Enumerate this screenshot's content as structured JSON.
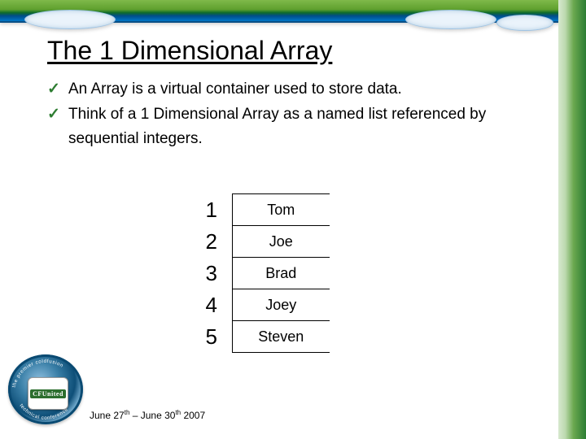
{
  "title": "The 1 Dimensional Array",
  "bullets": [
    "An Array is a virtual container used to store data.",
    "Think of a 1 Dimensional Array as a named list referenced by sequential integers."
  ],
  "array_items": [
    {
      "index": "1",
      "value": "Tom"
    },
    {
      "index": "2",
      "value": "Joe"
    },
    {
      "index": "3",
      "value": "Brad"
    },
    {
      "index": "4",
      "value": "Joey"
    },
    {
      "index": "5",
      "value": "Steven"
    }
  ],
  "logo": {
    "inner_text": "CFUnited",
    "ring_text_top": "the premier coldfusion",
    "ring_text_bottom": "technical conference"
  },
  "footer": {
    "from_day": "27",
    "from_sup": "th",
    "sep": " – ",
    "to_day": "30",
    "to_sup": "th",
    "month_prefix": "June ",
    "year": " 2007"
  },
  "check_glyph": "✓"
}
